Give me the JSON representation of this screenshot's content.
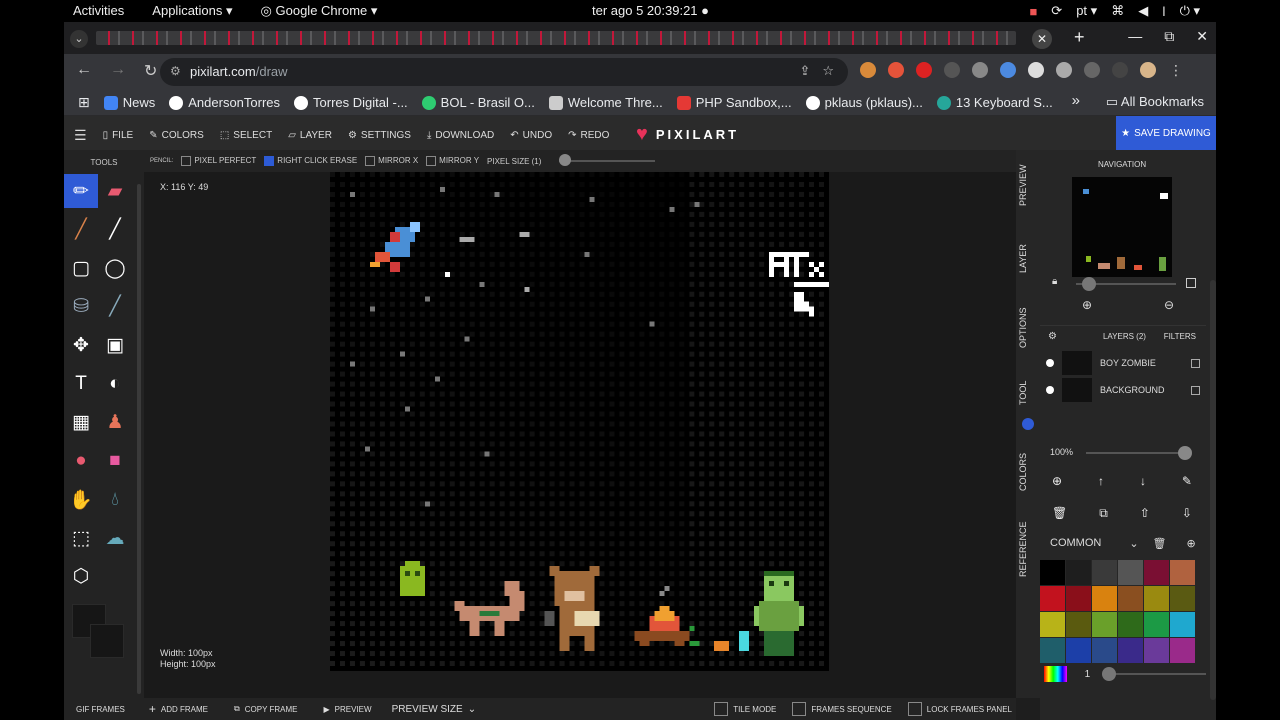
{
  "gnome": {
    "activities": "Activities",
    "applications": "Applications ▾",
    "app_name": "Google Chrome ▾",
    "clock": "ter ago 5  20:39:21",
    "lang": "pt ▾"
  },
  "chrome": {
    "url_host": "pixilart.com",
    "url_path": "/draw",
    "bookmarks": [
      {
        "label": "News",
        "color": "#4285f4"
      },
      {
        "label": "AndersonTorres",
        "color": "#ffffff"
      },
      {
        "label": "Torres Digital -...",
        "color": "#ffffff"
      },
      {
        "label": "BOL - Brasil O...",
        "color": "#2ecc71"
      },
      {
        "label": "Welcome Thre...",
        "color": "#cccccc"
      },
      {
        "label": "PHP Sandbox,...",
        "color": "#e53935"
      },
      {
        "label": "pklaus (pklaus)...",
        "color": "#ffffff"
      },
      {
        "label": "13 Keyboard S...",
        "color": "#26a69a"
      }
    ],
    "all_bookmarks": "All Bookmarks"
  },
  "app": {
    "menu": {
      "file": "FILE",
      "colors": "COLORS",
      "select": "SELECT",
      "layer": "LAYER",
      "settings": "SETTINGS",
      "download": "DOWNLOAD",
      "undo": "UNDO",
      "redo": "REDO"
    },
    "logo": "PIXILART",
    "save": "SAVE DRAWING",
    "options": {
      "pencil": "PENCIL:",
      "pixel_perfect": "PIXEL PERFECT",
      "right_click_erase": "RIGHT CLICK ERASE",
      "mirror_x": "MIRROR X",
      "mirror_y": "MIRROR Y",
      "pixel_size": "PIXEL SIZE (1)"
    },
    "tools_title": "TOOLS",
    "coords": "X: 116 Y: 49",
    "width": "Width: 100px",
    "height": "Height: 100px",
    "side_tabs": [
      "PREVIEW",
      "LAYER",
      "OPTIONS",
      "TOOL",
      "COLORS",
      "REFERENCE"
    ],
    "navigation": "NAVIGATION",
    "layers_label": "LAYERS (2)",
    "filters_label": "FILTERS",
    "layers": [
      {
        "name": "BOY ZOMBIE"
      },
      {
        "name": "BACKGROUND"
      }
    ],
    "opacity": "100%",
    "palette_name": "COMMON",
    "palette_colors": [
      "#000000",
      "#1e1e1e",
      "#3a3a3a",
      "#555555",
      "#7a0f33",
      "#b0623f",
      "#c2121e",
      "#8a0f1a",
      "#d9820f",
      "#8a4f20",
      "#9a8a10",
      "#5a5a12",
      "#b8b318",
      "#5a5a0f",
      "#6aa02a",
      "#2e6a1a",
      "#1c9a45",
      "#1fa8cf",
      "#1f5e6a",
      "#1c3fa8",
      "#2a4a8a",
      "#3a2a8a",
      "#6a3a9a",
      "#9a2a8a"
    ],
    "palette_count": "1",
    "bottom": {
      "gif_frames": "GIF FRAMES",
      "add_frame": "ADD FRAME",
      "copy_frame": "COPY FRAME",
      "preview": "PREVIEW",
      "preview_size": "PREVIEW SIZE",
      "tile_mode": "TILE MODE",
      "frames_sequence": "FRAMES SEQUENCE",
      "lock_frames": "LOCK FRAMES PANEL"
    }
  }
}
